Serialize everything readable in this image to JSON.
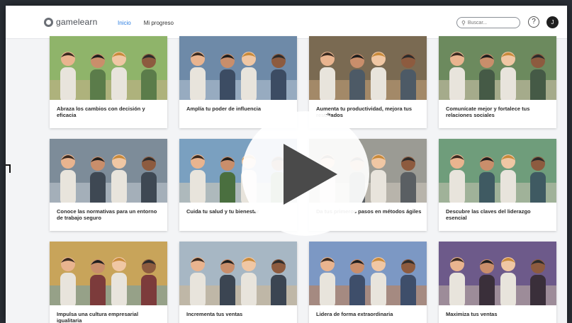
{
  "header": {
    "logo_text": "gamelearn",
    "nav": [
      {
        "label": "Inicio",
        "active": true
      },
      {
        "label": "Mi progreso",
        "active": false
      }
    ],
    "search_placeholder": "Buscar...",
    "help_label": "?",
    "avatar_initial": "J"
  },
  "courses": [
    {
      "title": "Abraza los cambios con decisión y eficacia",
      "colors": [
        "#8fb46a",
        "#5b7c4a",
        "#c8b08a"
      ]
    },
    {
      "title": "Amplía tu poder de influencia",
      "colors": [
        "#6e8aa8",
        "#3c4c63",
        "#b9c6d3"
      ]
    },
    {
      "title": "Aumenta tu productividad, mejora tus resultados",
      "colors": [
        "#7a6a52",
        "#4d5a66",
        "#c4a27a"
      ]
    },
    {
      "title": "Comunícate mejor y fortalece tus relaciones sociales",
      "colors": [
        "#6c8a5e",
        "#455a46",
        "#d6c7b0"
      ]
    },
    {
      "title": "Conoce las normativas para un entorno de trabajo seguro",
      "colors": [
        "#7d8c99",
        "#3e4853",
        "#c5ccd3"
      ]
    },
    {
      "title": "Cuida tu salud y tu bienestar",
      "colors": [
        "#7aa0c0",
        "#4a6f3f",
        "#d8cdb8"
      ]
    },
    {
      "title": "Da tus primeros pasos en métodos ágiles",
      "colors": [
        "#9b9b94",
        "#5a5f63",
        "#cfc9bd"
      ]
    },
    {
      "title": "Descubre las claves del liderazgo esencial",
      "colors": [
        "#6f9d7b",
        "#3f5a62",
        "#c9c2b3"
      ]
    },
    {
      "title": "Impulsa una cultura empresarial igualitaria",
      "colors": [
        "#c8a45a",
        "#7c3b3b",
        "#6d9fae"
      ]
    },
    {
      "title": "Incrementa tus ventas",
      "colors": [
        "#a7b7c4",
        "#3b4552",
        "#d3b890"
      ]
    },
    {
      "title": "Lidera de forma extraordinaria",
      "colors": [
        "#7c98c4",
        "#3e4e6a",
        "#c77f4a"
      ]
    },
    {
      "title": "Maximiza tus ventas",
      "colors": [
        "#6d5a8a",
        "#3a2f3a",
        "#c5b6a6"
      ]
    }
  ]
}
